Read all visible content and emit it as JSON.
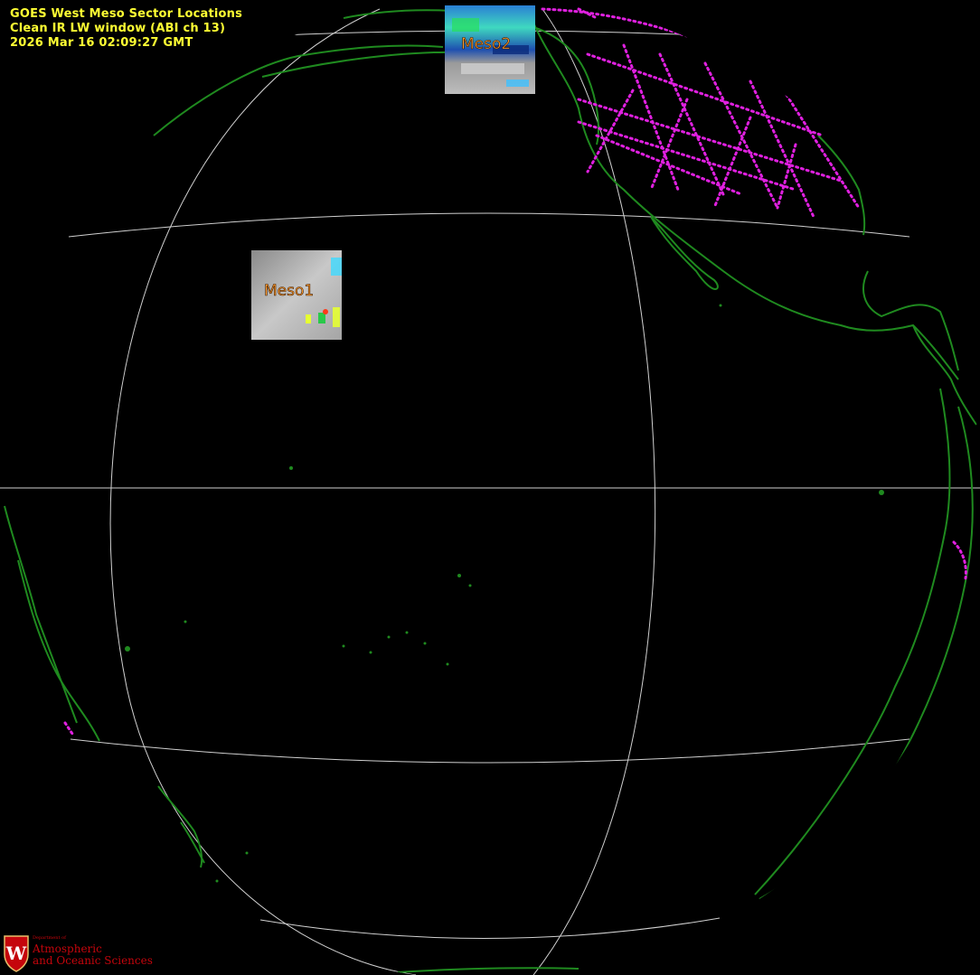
{
  "header": {
    "title": "GOES West Meso Sector Locations",
    "product": "Clean IR LW window (ABI ch 13)",
    "timestamp": "2026 Mar 16  02:09:27 GMT"
  },
  "sectors": [
    {
      "label": "Meso1"
    },
    {
      "label": "Meso2"
    }
  ],
  "logo": {
    "letter": "W",
    "department": "Department of",
    "line1": "Atmospheric",
    "line2": "and Oceanic Sciences"
  },
  "colors": {
    "header_text": "#ffff33",
    "coastline": "#1f8a1f",
    "political_borders": "#e020e0",
    "graticule": "#d0d0d0",
    "sector_label": "#ff9a2a",
    "logo": "#c5050c"
  }
}
